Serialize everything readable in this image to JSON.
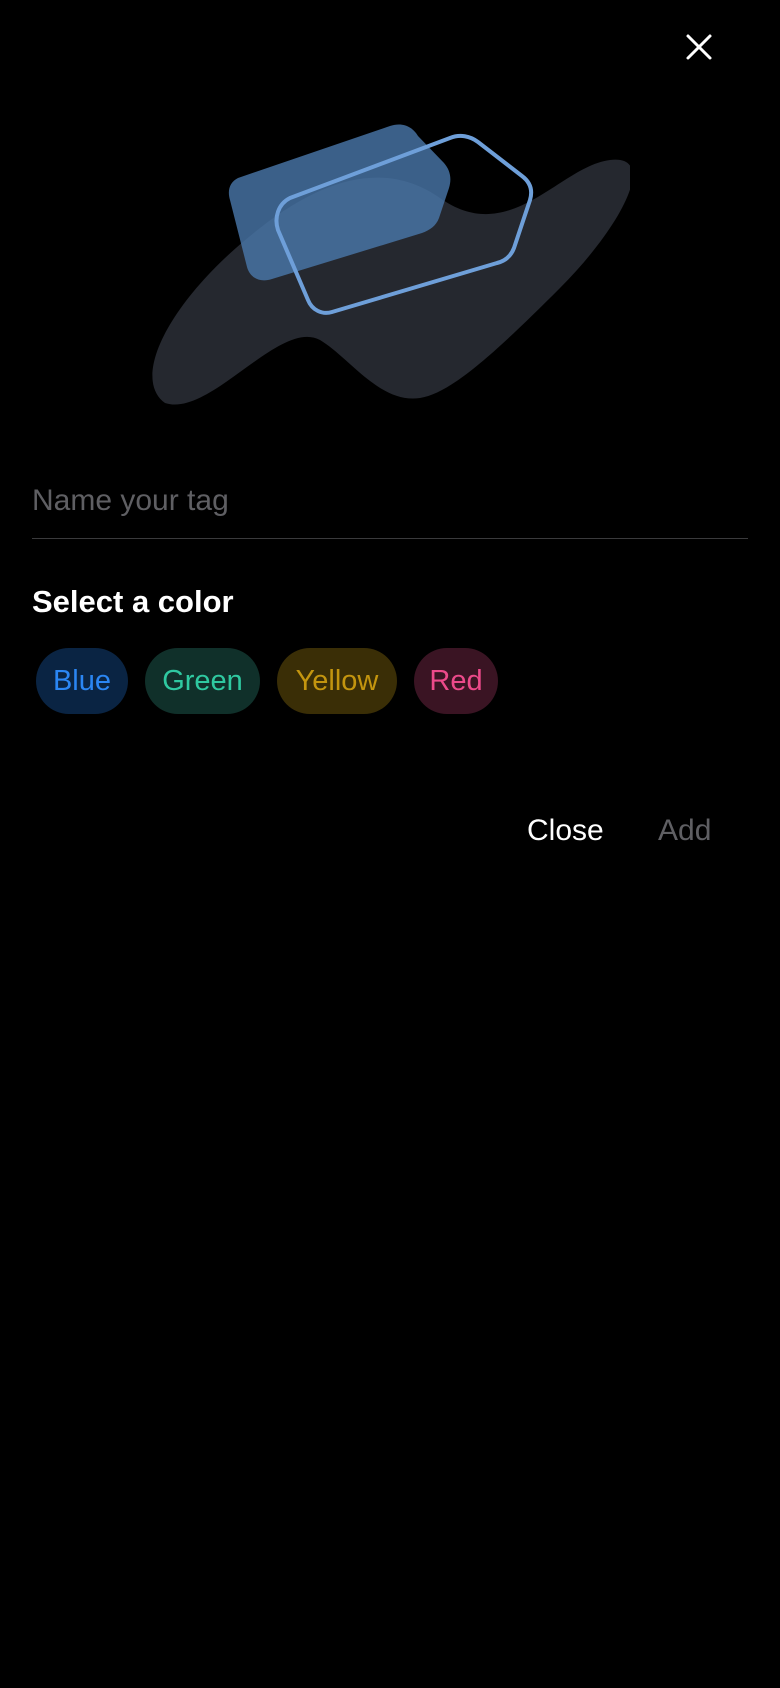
{
  "tag_name": {
    "value": "",
    "placeholder": "Name your tag"
  },
  "color_section": {
    "title": "Select a color",
    "options": [
      {
        "label": "Blue",
        "text_color": "#2b86f3",
        "bg_color": "#0a2443"
      },
      {
        "label": "Green",
        "text_color": "#2fc8a0",
        "bg_color": "#10302a"
      },
      {
        "label": "Yellow",
        "text_color": "#c3950f",
        "bg_color": "#3a2e06"
      },
      {
        "label": "Red",
        "text_color": "#ec4a8a",
        "bg_color": "#3a1423"
      }
    ]
  },
  "actions": {
    "close_label": "Close",
    "add_label": "Add"
  },
  "icons": {
    "dismiss": "close-icon",
    "illustration": "tag-illustration"
  },
  "colors": {
    "background": "#000000",
    "text_primary": "#ffffff",
    "text_disabled": "#5f5f63",
    "illustration_blob": "#25282f",
    "illustration_card": "#4a78ab",
    "illustration_outline": "#6e9fd9"
  }
}
